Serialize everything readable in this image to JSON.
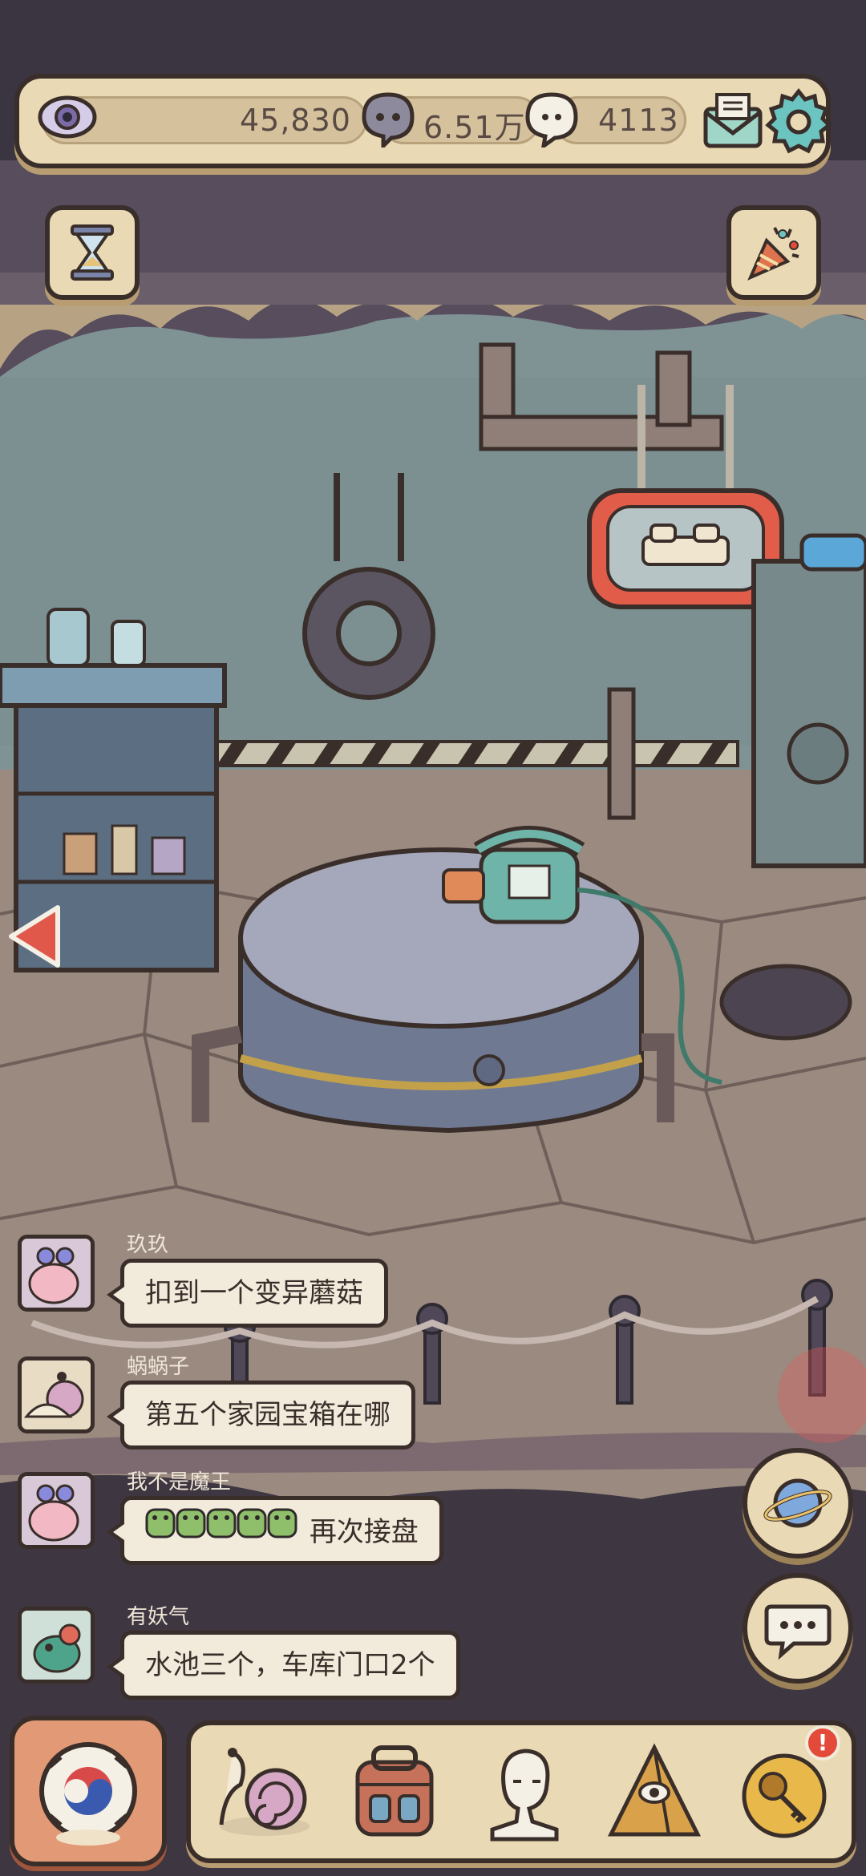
{
  "resources": {
    "eye_value": "45,830",
    "snail_coin_value": "6.51万",
    "bubble_value": "4113",
    "eye_icon": "eye-icon",
    "snail_coin_icon": "snail-coin-icon",
    "bubble_icon": "speech-bubble-icon"
  },
  "top_buttons": {
    "mail_icon": "mail-icon",
    "settings_icon": "gear-icon",
    "hourglass_icon": "hourglass-icon",
    "party_icon": "party-popper-icon"
  },
  "chat": [
    {
      "name": "玖玖",
      "message": "扣到一个变异蘑菇",
      "emotes": 0
    },
    {
      "name": "蜗蜗子",
      "message": "第五个家园宝箱在哪",
      "emotes": 0
    },
    {
      "name": "我不是魔王",
      "message": "再次接盘",
      "emotes": 5
    },
    {
      "name": "有妖气",
      "message": "水池三个，车库门口2个",
      "emotes": 0
    }
  ],
  "side_buttons": {
    "planet_icon": "planet-icon",
    "chat_icon": "chat-bubble-icon"
  },
  "bottom_nav": [
    {
      "icon": "snail-icon"
    },
    {
      "icon": "backpack-icon"
    },
    {
      "icon": "statue-icon"
    },
    {
      "icon": "pyramid-icon"
    },
    {
      "icon": "key-coin-icon",
      "badge": "!"
    }
  ],
  "main_button": {
    "icon": "korea-flag-snail-icon"
  },
  "colors": {
    "panel": "#e9d9b4",
    "outline": "#3a2e2a",
    "accent_red": "#e44a3a",
    "wall": "#7f9294",
    "floor": "#9c8b80"
  }
}
